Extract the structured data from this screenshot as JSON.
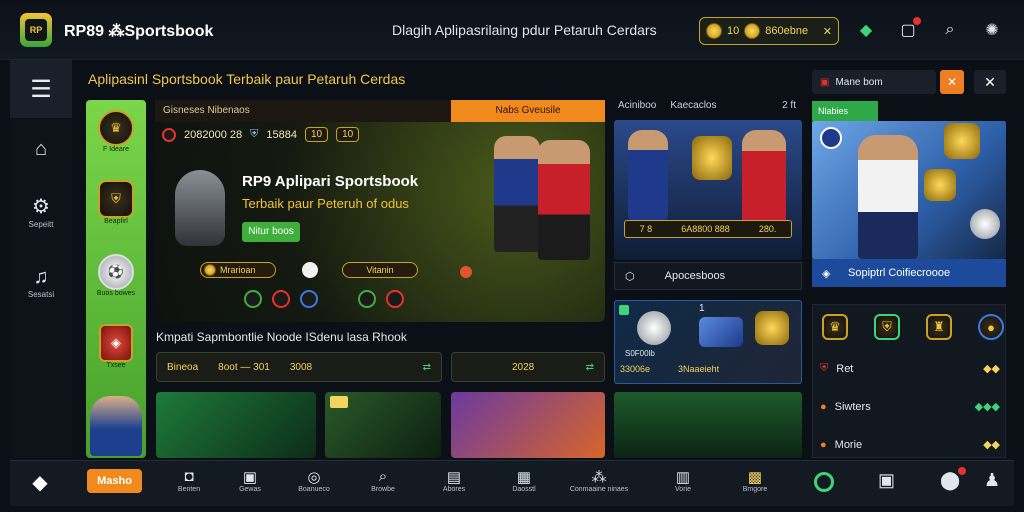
{
  "header": {
    "brand": "RP89 ⁂Sportsbook",
    "tagline": "Dlagih Aplipasrilaing pdur Petaruh Cerdars",
    "balance_left": "10",
    "balance_right": "860ebne"
  },
  "rail": {
    "items": [
      {
        "label": "",
        "icon": "home-icon"
      },
      {
        "label": "Sepeitt",
        "icon": "settings-icon"
      },
      {
        "label": "Sesatsi",
        "icon": "music-icon"
      }
    ]
  },
  "headline": "Aplipasinl Sportsbook Terbaik paur Petaruh Cerdas",
  "leagues": [
    {
      "label": "F Ideare"
    },
    {
      "label": "Beapfirl"
    },
    {
      "label": "Buos bowes"
    },
    {
      "label": "Txsee"
    }
  ],
  "center": {
    "tab_left": "Gisneses Nibenaos",
    "tab_right": "Nabs Gveusile",
    "score_left": "2082000 28",
    "score_mid": "15884",
    "pill1": "10",
    "pill2": "10",
    "hero_title": "RP9 Aplipari Sportsbook",
    "hero_sub": "Terbaik paur Peteruh of odus",
    "hero_btn": "Nitur boos",
    "chip1": "Mrarioan",
    "chip2": "Vitanin"
  },
  "promo_line": "Kmpati Sapmbontlie Noode ISdenu lasa Rhook",
  "bet_bar": {
    "a": "Bineoa",
    "b": "8oot — 301",
    "c": "3008",
    "d": "2028"
  },
  "rc1": {
    "head1": "Aciniboo",
    "head2": "Kaecaclos",
    "head3": "2 ft",
    "bar1": "7 8",
    "bar2": "6A8800 888",
    "bar3": "280.",
    "foot": "Apocesboos",
    "card_num": "1",
    "card_sub": "S0F00lb",
    "card_bar1": "33006e",
    "card_bar2": "3Naaeieht"
  },
  "rc2": {
    "input": "Mane bom",
    "tab": "Nlabies",
    "foot": "Sopiptrl Coifiecroooe",
    "rows": [
      {
        "label": "Ret"
      },
      {
        "label": "Siwters"
      },
      {
        "label": "Morie"
      }
    ]
  },
  "bottom": {
    "active": "Masho",
    "items": [
      {
        "label": "Benten",
        "icon": "chat-icon"
      },
      {
        "label": "Gewas",
        "icon": "image-icon"
      },
      {
        "label": "Boanueco",
        "icon": "target-icon"
      },
      {
        "label": "Browbe",
        "icon": "search-icon"
      },
      {
        "label": "Abores",
        "icon": "bag-icon"
      },
      {
        "label": "Daosstl",
        "icon": "gift-icon"
      },
      {
        "label": "Conmaaine ninaes",
        "icon": "text-icon"
      },
      {
        "label": "Vorie",
        "icon": "trophy-icon"
      },
      {
        "label": "Bmgore",
        "icon": "calendar-icon"
      }
    ]
  }
}
